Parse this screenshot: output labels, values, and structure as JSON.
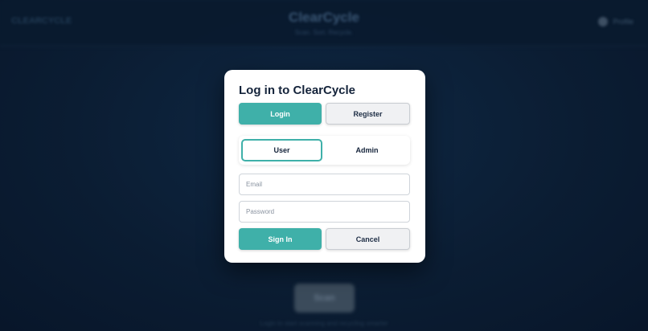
{
  "background": {
    "brand": "CLEARCYCLE",
    "title": "ClearCycle",
    "subtitle": "Scan. Sort. Recycle.",
    "profile_label": "Profile",
    "scan_button": "Scan",
    "hint": "Login to start scanning and recycling smarter"
  },
  "modal": {
    "title": "Log in to ClearCycle",
    "tabs": {
      "login": "Login",
      "register": "Register"
    },
    "roles": {
      "user": "User",
      "admin": "Admin"
    },
    "email": {
      "placeholder": "Email",
      "value": ""
    },
    "password": {
      "placeholder": "Password",
      "value": ""
    },
    "actions": {
      "sign_in": "Sign In",
      "cancel": "Cancel"
    }
  },
  "colors": {
    "accent": "#3fb0a9",
    "background": "#0b1a2e",
    "text": "#14233a"
  }
}
